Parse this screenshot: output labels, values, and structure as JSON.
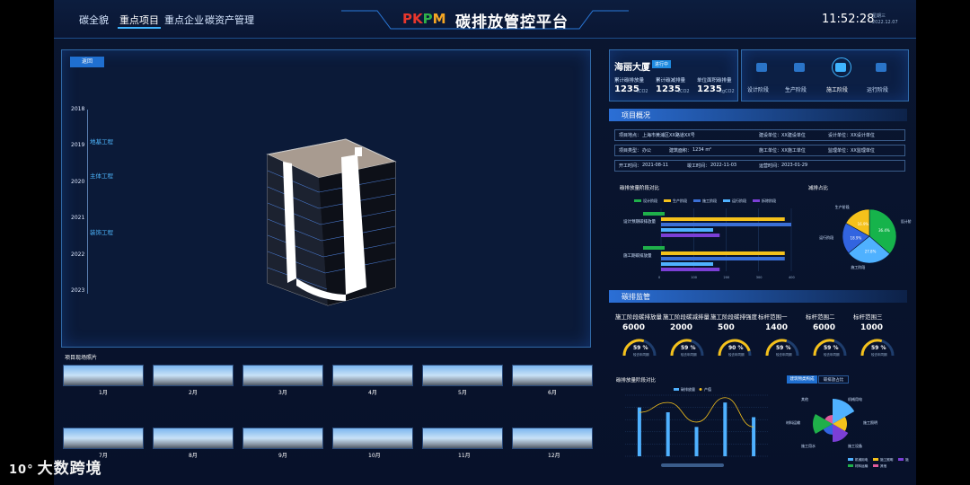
{
  "nav": [
    "碳全貌",
    "重点项目",
    "重点企业",
    "碳资产管理"
  ],
  "logo": "PKPM",
  "title": "碳排放管控平台",
  "clock": {
    "time": "11:52:28",
    "weekday": "星期三",
    "date": "2022.12.07"
  },
  "back_button": "返回",
  "timeline": {
    "years": [
      "2018",
      "2019",
      "2020",
      "2021",
      "2022",
      "2023"
    ],
    "stages": [
      "地基工程",
      "主体工程",
      "装饰工程"
    ]
  },
  "photos": {
    "title": "项目现场照片",
    "months": [
      "1月",
      "2月",
      "3月",
      "4月",
      "5月",
      "6月",
      "7月",
      "8月",
      "9月",
      "10月",
      "11月",
      "12月"
    ]
  },
  "project": {
    "name": "海丽大厦",
    "badge": "进行中",
    "stats": [
      {
        "label": "累计碳排放量",
        "value": "1235",
        "unit": "tCO2"
      },
      {
        "label": "累计碳减排量",
        "value": "1235",
        "unit": "tCO2"
      },
      {
        "label": "单位面积碳排量",
        "value": "1235",
        "unit": "kgCO2"
      }
    ],
    "phases": [
      "设计阶段",
      "生产阶段",
      "施工阶段",
      "运行阶段"
    ]
  },
  "overview": {
    "title": "项目概况",
    "rows": [
      [
        "项目地点：",
        "上海市黄浦区XX路道XX号",
        "建设单位：",
        "XX建设单位",
        "设计单位：",
        "XX设计单位"
      ],
      [
        "项目类型：",
        "办公",
        "建筑面积：",
        "1234 m²",
        "施工单位：",
        "XX施工单位",
        "监理单位：",
        "XX监理单位"
      ],
      [
        "开工时间：",
        "2021-08-11",
        "竣工时间：",
        "2022-11-03",
        "运营时间：",
        "2023-01-29"
      ]
    ]
  },
  "bar_chart_title": "碳排放量阶段对比",
  "bar_chart_legend": [
    "设计阶段",
    "生产阶段",
    "施工阶段",
    "运行阶段",
    "拆除阶段"
  ],
  "bar_chart_groups": [
    "设计预期碳排放量",
    "施工期碳排放量"
  ],
  "pie_title": "减排占比",
  "pie_labels": [
    "设计阶段",
    "施工阶段",
    "运行阶段",
    "生产阶段"
  ],
  "pie_values": [
    "36.4%",
    "27.8%",
    "18.9%",
    "16.9%"
  ],
  "monitor": {
    "title": "碳排监管",
    "kpis": [
      {
        "name": "施工阶段碳排放量",
        "value": "6000",
        "pct": "59 %"
      },
      {
        "name": "施工阶段碳减排量",
        "value": "2000",
        "pct": "59 %"
      },
      {
        "name": "施工阶段碳排强度",
        "value": "500",
        "pct": "90 %"
      },
      {
        "name": "标杆范围一",
        "value": "1400",
        "pct": "59 %"
      },
      {
        "name": "标杆范围二",
        "value": "6000",
        "pct": "59 %"
      },
      {
        "name": "标杆范围三",
        "value": "1000",
        "pct": "59 %"
      }
    ],
    "gauge_sub": "较去年同期"
  },
  "combo_title": "碳排放量阶段对比",
  "combo_legend": [
    "碳排放量",
    "产值"
  ],
  "rose_tabs": [
    "建筑物类构成",
    "碳排放占比"
  ],
  "rose_labels": [
    "机械用电",
    "施工照明",
    "施工设备",
    "施工用水",
    "材料运输",
    "其他"
  ],
  "watermark": "大数跨境",
  "chart_data": [
    {
      "type": "bar",
      "title": "碳排放量阶段对比",
      "categories": [
        "设计预期碳排放量",
        "施工期碳排放量"
      ],
      "series": [
        {
          "name": "设计阶段",
          "values": [
            120,
            120
          ]
        },
        {
          "name": "生产阶段",
          "values": [
            380,
            380
          ]
        },
        {
          "name": "施工阶段",
          "values": [
            400,
            380
          ]
        },
        {
          "name": "运行阶段",
          "values": [
            160,
            160
          ]
        },
        {
          "name": "拆除阶段",
          "values": [
            180,
            180
          ]
        }
      ],
      "xlim": [
        0,
        400
      ],
      "colors": [
        "#1fb04a",
        "#f5c11b",
        "#3b6fd6",
        "#4fb1ff",
        "#7b3fd6"
      ]
    },
    {
      "type": "pie",
      "title": "减排占比",
      "labels": [
        "设计阶段",
        "施工阶段",
        "运行阶段",
        "生产阶段"
      ],
      "values": [
        36.4,
        27.8,
        18.9,
        16.9
      ],
      "colors": [
        "#16b34b",
        "#4fb1ff",
        "#3264e0",
        "#f5c11b"
      ]
    },
    {
      "type": "bar",
      "title": "碳排放量阶段对比",
      "categories": [
        "1",
        "2",
        "3",
        "4",
        "5"
      ],
      "series": [
        {
          "name": "碳排放量",
          "values": [
            20,
            18,
            12,
            22,
            16
          ]
        },
        {
          "name": "产值",
          "values": [
            18,
            22,
            14,
            24,
            12
          ]
        }
      ],
      "ylim": [
        0,
        25
      ]
    }
  ]
}
